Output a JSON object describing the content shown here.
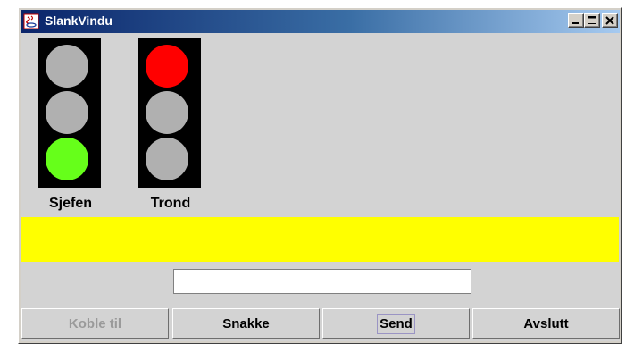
{
  "window": {
    "title": "SlankVindu",
    "controls": {
      "minimize_icon": "minimize-icon",
      "maximize_icon": "maximize-icon",
      "close_icon": "close-icon"
    }
  },
  "traffic_lights": [
    {
      "label": "Sjefen",
      "state": "green",
      "lamps": [
        "#b0b0b0",
        "#b0b0b0",
        "#66ff1a"
      ]
    },
    {
      "label": "Trond",
      "state": "red",
      "lamps": [
        "#ff0000",
        "#b0b0b0",
        "#b0b0b0"
      ]
    }
  ],
  "status_message": "",
  "message_input": {
    "value": "",
    "placeholder": ""
  },
  "buttons": {
    "connect": {
      "label": "Koble til",
      "enabled": false
    },
    "talk": {
      "label": "Snakke",
      "enabled": true
    },
    "send": {
      "label": "Send",
      "enabled": true,
      "focused": true
    },
    "quit": {
      "label": "Avslutt",
      "enabled": true
    }
  },
  "colors": {
    "status_bar": "#ffff00",
    "background": "#d3d3d3",
    "light_housing": "#000000"
  }
}
